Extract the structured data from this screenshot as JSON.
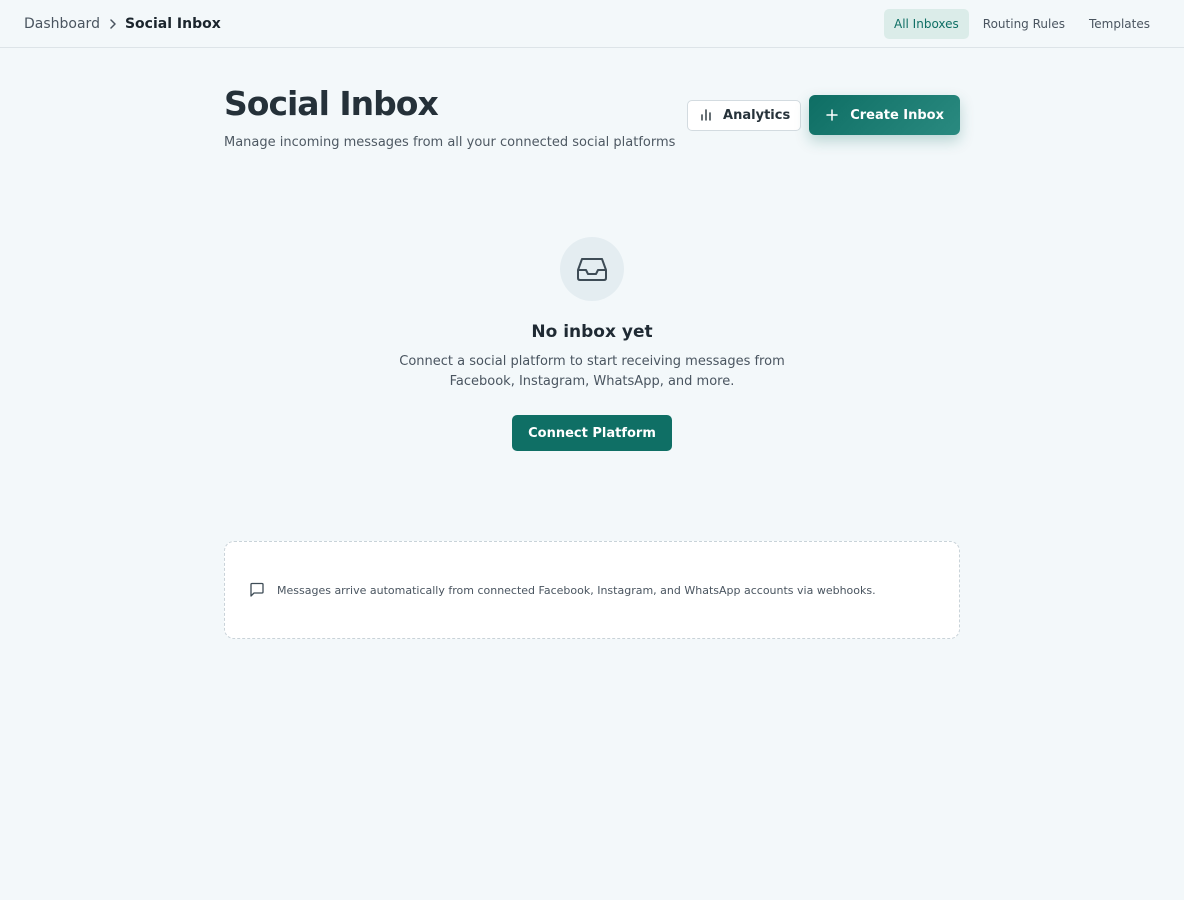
{
  "breadcrumb": {
    "parent": "Dashboard",
    "current": "Social Inbox"
  },
  "nav": {
    "tabs": [
      {
        "label": "All Inboxes",
        "active": true
      },
      {
        "label": "Routing Rules",
        "active": false
      },
      {
        "label": "Templates",
        "active": false
      }
    ]
  },
  "header": {
    "title": "Social Inbox",
    "subtitle": "Manage incoming messages from all your connected social platforms",
    "analytics_label": "Analytics",
    "create_label": "Create Inbox"
  },
  "empty_state": {
    "icon": "inbox-icon",
    "title": "No inbox yet",
    "description": "Connect a social platform to start receiving messages from Facebook, Instagram, WhatsApp, and more.",
    "cta_label": "Connect Platform"
  },
  "info": {
    "icon": "message-square-icon",
    "text": "Messages arrive automatically from connected Facebook, Instagram, and WhatsApp accounts via webhooks."
  },
  "colors": {
    "accent": "#0f6f65",
    "background": "#f3f8fa"
  }
}
